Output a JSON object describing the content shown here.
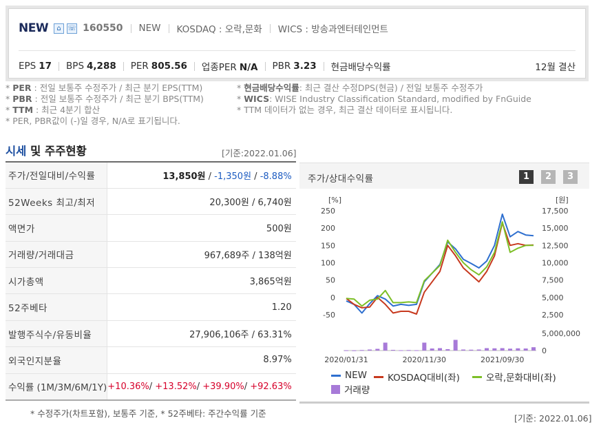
{
  "header": {
    "name": "NEW",
    "code": "160550",
    "name_en": "NEW",
    "market": "KOSDAQ : 오락,문화",
    "wics": "WICS : 방송과엔터테인먼트",
    "icons": [
      "home-icon",
      "ir-icon"
    ],
    "metrics": [
      {
        "label": "EPS",
        "value": "17"
      },
      {
        "label": "BPS",
        "value": "4,288"
      },
      {
        "label": "PER",
        "value": "805.56"
      },
      {
        "label": "업종PER",
        "value": "N/A"
      },
      {
        "label": "PBR",
        "value": "3.23"
      },
      {
        "label": "현금배당수익률",
        "value": ""
      }
    ],
    "settlement": "12월 결산"
  },
  "notes": {
    "left": [
      {
        "key": "PER",
        "text": ": 전일 보통주 수정주가 / 최근 분기 EPS(TTM)"
      },
      {
        "key": "PBR",
        "text": ": 전일 보통주 수정주가 / 최근 분기 BPS(TTM)"
      },
      {
        "key": "TTM",
        "text": ": 최근 4분기 합산"
      },
      {
        "key": "",
        "text": "PER, PBR값이 (-)일 경우, N/A로 표기됩니다."
      }
    ],
    "right": [
      {
        "key": "현금배당수익률",
        "text": ": 최근 결산 수정DPS(현금) / 전일 보통주 수정주가"
      },
      {
        "key": "WICS",
        "text": ": WISE Industry Classification Standard, modified by FnGuide"
      },
      {
        "key": "",
        "text": "TTM 데이터가 없는 경우, 최근 결산 데이터로 표시됩니다."
      }
    ]
  },
  "section": {
    "title_blue": "시세",
    "title_rest": " 및 주주현황",
    "base_date": "[기준:2022.01.06]"
  },
  "table": {
    "price_label": "주가/전일대비/수익률",
    "price": "13,850원",
    "price_sep1": " / ",
    "change": "-1,350원",
    "price_sep2": " / ",
    "change_pct": "-8.88%",
    "rows": [
      {
        "label": "52Weeks 최고/최저",
        "value": "20,300원 / 6,740원"
      },
      {
        "label": "액면가",
        "value": "500원"
      },
      {
        "label": "거래량/거래대금",
        "value": "967,689주 / 138억원"
      },
      {
        "label": "시가총액",
        "value": "3,865억원"
      },
      {
        "label": "52주베타",
        "value": "1.20"
      },
      {
        "label": "발행주식수/유동비율",
        "value": "27,906,106주 / 63.31%"
      },
      {
        "label": "외국인지분율",
        "value": "8.97%"
      }
    ],
    "returns_label": "수익률 (1M/3M/6M/1Y)",
    "returns": [
      "+10.36%",
      "+13.52%",
      "+39.90%",
      "+92.63%"
    ],
    "returns_sep": "/ ",
    "footnote": "* 수정주가(차트포함), 보통주 기준, * 52주베타: 주간수익률 기준"
  },
  "chart_panel": {
    "title": "주가/상대수익률",
    "pages": [
      "1",
      "2",
      "3"
    ],
    "active_page": 0,
    "base_date": "[기준: 2022.01.06]"
  },
  "chart_data": {
    "type": "line",
    "x": [
      "2020/01/31",
      "2020/02/29",
      "2020/03/31",
      "2020/04/30",
      "2020/05/31",
      "2020/06/30",
      "2020/07/31",
      "2020/08/31",
      "2020/09/30",
      "2020/10/31",
      "2020/11/30",
      "2020/12/31",
      "2021/01/31",
      "2021/02/28",
      "2021/03/31",
      "2021/04/30",
      "2021/05/31",
      "2021/06/30",
      "2021/07/31",
      "2021/08/31",
      "2021/09/30",
      "2021/10/31",
      "2021/11/30",
      "2021/12/31",
      "2022/01/06"
    ],
    "x_tick_labels": [
      "2020/01/31",
      "2020/11/30",
      "2021/09/30"
    ],
    "left_axis": {
      "unit": "[%]",
      "ticks": [
        -50,
        0,
        50,
        100,
        150,
        200,
        250
      ],
      "ylim": [
        -50,
        250
      ]
    },
    "right_axis": {
      "unit": "[원]",
      "ticks": [
        "2,500",
        "5,000",
        "7,500",
        "10,000",
        "12,500",
        "15,000",
        "17,500"
      ],
      "ylim": [
        2500,
        17500
      ]
    },
    "volume_axis": {
      "ticks": [
        "0",
        "5,000,000"
      ],
      "ylim": [
        0,
        5000000
      ]
    },
    "series": [
      {
        "name": "NEW",
        "color": "#2e6fcf",
        "values": [
          -10,
          -20,
          -45,
          -18,
          5,
          -5,
          -25,
          -20,
          -23,
          -20,
          45,
          70,
          95,
          160,
          140,
          110,
          98,
          85,
          105,
          150,
          240,
          175,
          190,
          180,
          178
        ]
      },
      {
        "name": "KOSDAQ대비(좌)",
        "color": "#c7391e",
        "values": [
          -3,
          -20,
          -30,
          -28,
          0,
          -20,
          -45,
          -40,
          -40,
          -48,
          15,
          45,
          75,
          150,
          120,
          85,
          65,
          45,
          75,
          120,
          215,
          150,
          155,
          150,
          151
        ]
      },
      {
        "name": "오락,문화대비(좌)",
        "color": "#7dbf27",
        "values": [
          -3,
          -5,
          -25,
          -8,
          -5,
          20,
          -15,
          -15,
          -13,
          -15,
          48,
          70,
          92,
          165,
          130,
          100,
          80,
          65,
          88,
          130,
          218,
          130,
          142,
          150,
          150
        ]
      }
    ],
    "volume": {
      "name": "거래량",
      "color": "#a77ad8",
      "values": [
        80000,
        60000,
        150000,
        300000,
        500000,
        2300000,
        200000,
        100000,
        150000,
        100000,
        2300000,
        600000,
        700000,
        400000,
        3100000,
        300000,
        250000,
        300000,
        700000,
        650000,
        700000,
        550000,
        650000,
        600000,
        968000
      ]
    }
  }
}
